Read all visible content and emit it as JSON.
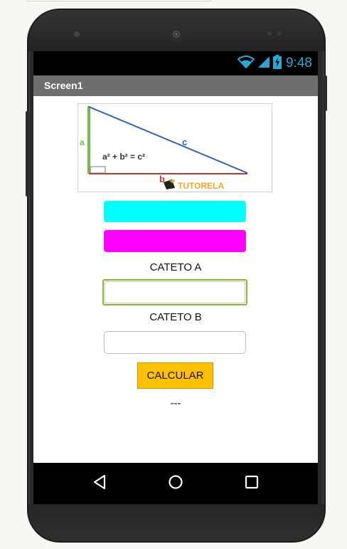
{
  "status_bar": {
    "time": "9:48",
    "icons": [
      "wifi-icon",
      "signal-icon",
      "battery-charging-icon"
    ],
    "accent_color": "#27a9d6"
  },
  "title_bar": {
    "title": "Screen1"
  },
  "image": {
    "formula": "a² + b² = c²",
    "side_a": "a",
    "side_b": "b",
    "side_c": "c",
    "brand": "TUTORELA"
  },
  "buttons": {
    "cyan_color": "#00ffff",
    "magenta_color": "#ff00ff",
    "calculate_label": "CALCULAR",
    "calculate_color": "#ffc000"
  },
  "form": {
    "label_a": "CATETO A",
    "value_a": "",
    "label_b": "CATETO B",
    "value_b": ""
  },
  "result": {
    "text": "---"
  },
  "nav": {
    "icons": [
      "back-icon",
      "home-icon",
      "recents-icon"
    ]
  }
}
